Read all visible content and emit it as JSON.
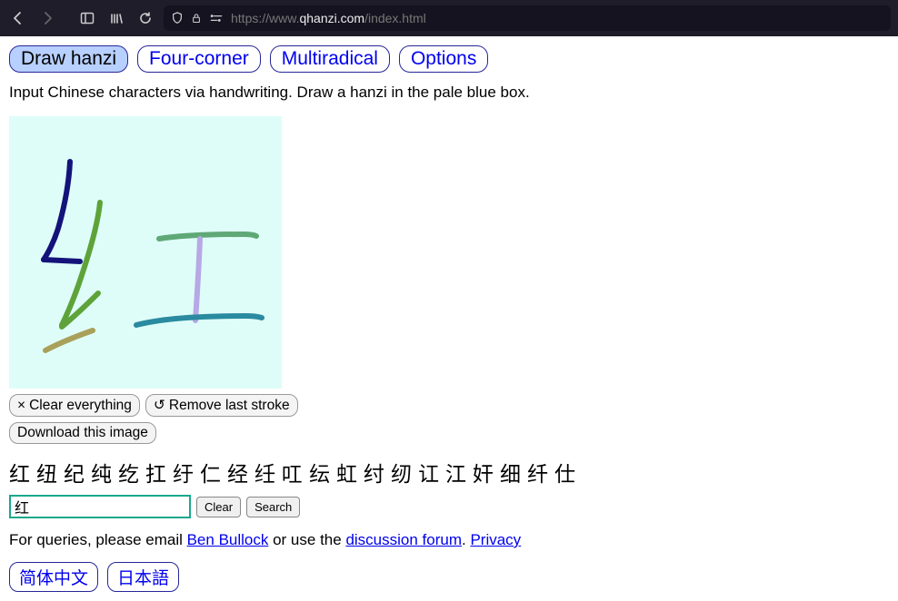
{
  "chrome": {
    "url_prefix": "https://www.",
    "url_host": "qhanzi.com",
    "url_path": "/index.html"
  },
  "tabs": {
    "draw": "Draw hanzi",
    "fourcorner": "Four-corner",
    "multiradical": "Multiradical",
    "options": "Options"
  },
  "instructions": "Input Chinese characters via handwriting. Draw a hanzi in the pale blue box.",
  "buttons": {
    "clear_everything": "Clear everything",
    "remove_last": "Remove last stroke",
    "download": "Download this image",
    "clear": "Clear",
    "search": "Search"
  },
  "candidates": [
    "红",
    "纽",
    "纪",
    "纯",
    "纥",
    "扛",
    "纡",
    "仁",
    "经",
    "纴",
    "叿",
    "纭",
    "虹",
    "纣",
    "纫",
    "讧",
    "江",
    "奸",
    "细",
    "纤",
    "仕"
  ],
  "input_value": "红",
  "footer": {
    "prefix": "For queries, please email ",
    "email_name": "Ben Bullock",
    "middle": " or use the ",
    "forum": "discussion forum",
    "period": ". ",
    "privacy": "Privacy"
  },
  "lang": {
    "zh": "简体中文",
    "ja": "日本語"
  }
}
